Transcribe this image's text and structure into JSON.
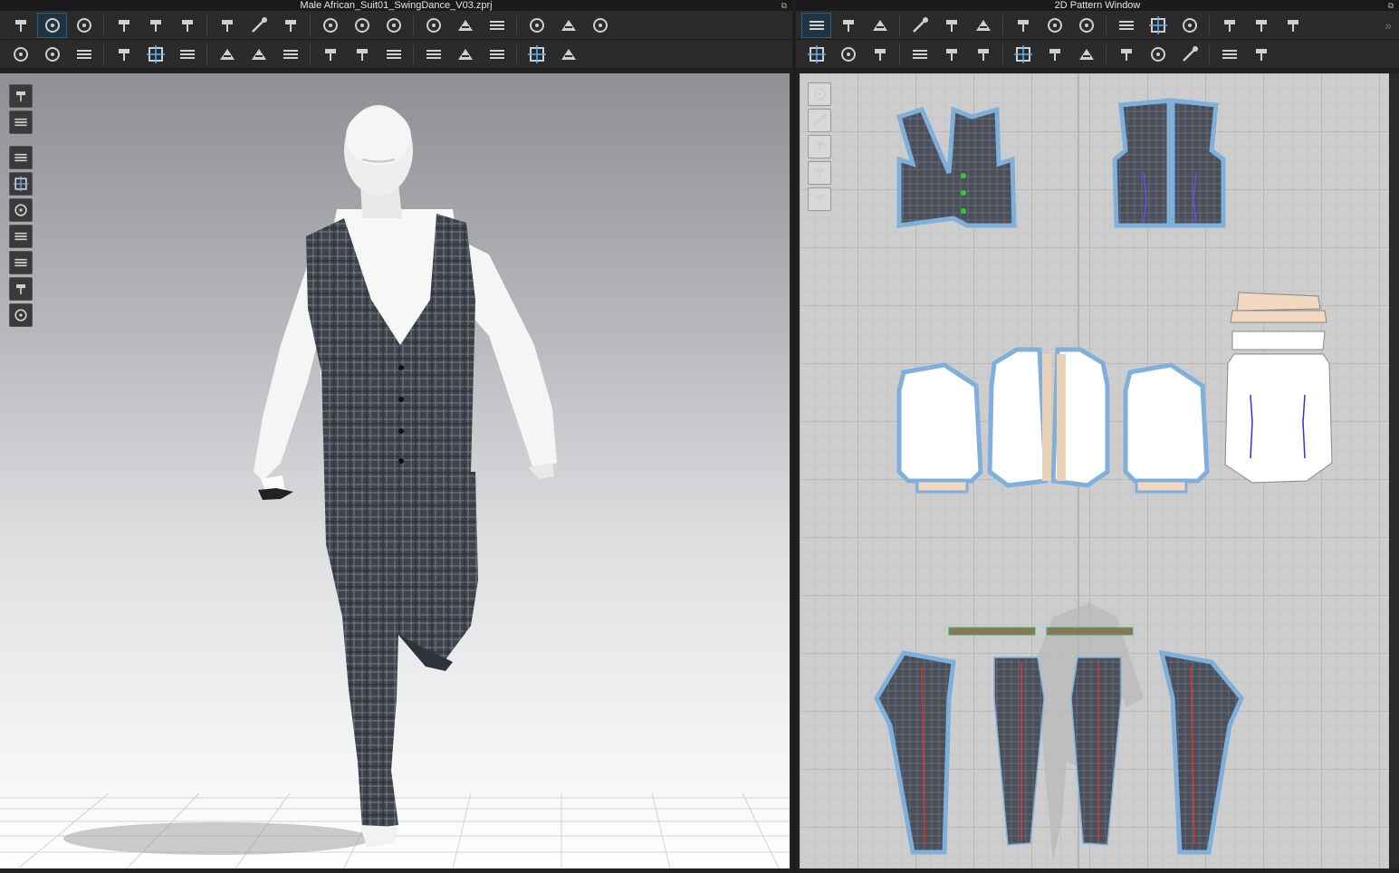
{
  "window3d": {
    "title": "Male African_Suit01_SwingDance_V03.zprj"
  },
  "window2d": {
    "title": "2D Pattern Window"
  },
  "toolbar3d_row1": [
    {
      "icon": "simulation-icon"
    },
    {
      "icon": "select-move-icon",
      "selected": true
    },
    {
      "icon": "transform-pattern-icon"
    },
    {
      "icon": "fold-arrangement-icon"
    },
    {
      "icon": "fold-icon"
    },
    {
      "icon": "fold-inner-icon"
    },
    {
      "icon": "tack-icon"
    },
    {
      "icon": "pin-icon"
    },
    {
      "icon": "strengthen-icon"
    },
    {
      "icon": "select-mesh-icon"
    },
    {
      "icon": "garment-fit-icon"
    },
    {
      "icon": "shirt-icon"
    },
    {
      "icon": "avatar-pose-icon"
    },
    {
      "icon": "measure-icon"
    },
    {
      "icon": "tape-measure-icon"
    },
    {
      "icon": "ruler-icon"
    },
    {
      "icon": "shirt-arrange-icon"
    },
    {
      "icon": "shirt-reset-icon"
    }
  ],
  "toolbar3d_row2": [
    {
      "icon": "avatar-walk-icon"
    },
    {
      "icon": "brush-icon"
    },
    {
      "icon": "stitch-icon"
    },
    {
      "icon": "seam-icon"
    },
    {
      "icon": "scissors-icon"
    },
    {
      "icon": "sewing-icon"
    },
    {
      "icon": "pattern-icon"
    },
    {
      "icon": "check-pattern-icon"
    },
    {
      "icon": "button-icon"
    },
    {
      "icon": "buttonhole-icon"
    },
    {
      "icon": "snap-icon"
    },
    {
      "icon": "zipper-icon"
    },
    {
      "icon": "piping-icon"
    },
    {
      "icon": "texture-icon"
    },
    {
      "icon": "texture-edit-icon"
    },
    {
      "icon": "gradient-icon"
    },
    {
      "icon": "stretch-icon"
    }
  ],
  "toolbar2d_row1": [
    {
      "icon": "edit-pattern-icon",
      "selected": true
    },
    {
      "icon": "edit-point-icon"
    },
    {
      "icon": "polygon-icon"
    },
    {
      "icon": "rectangle-icon"
    },
    {
      "icon": "internal-polygon-icon"
    },
    {
      "icon": "internal-rect-icon"
    },
    {
      "icon": "dart-icon"
    },
    {
      "icon": "trace-icon"
    },
    {
      "icon": "curve-icon"
    },
    {
      "icon": "fold-pattern-icon"
    },
    {
      "icon": "sew-line-icon"
    },
    {
      "icon": "grain-icon"
    },
    {
      "icon": "text-icon"
    },
    {
      "icon": "text-style-icon"
    },
    {
      "icon": "grid-icon"
    }
  ],
  "toolbar2d_row2": [
    {
      "icon": "segment-sewing-icon"
    },
    {
      "icon": "free-sewing-icon"
    },
    {
      "icon": "tuck-icon"
    },
    {
      "icon": "check-sewing-icon"
    },
    {
      "icon": "iron-icon"
    },
    {
      "icon": "garment-2d-icon"
    },
    {
      "icon": "shirt-2d-icon"
    },
    {
      "icon": "pattern-2d-icon"
    },
    {
      "icon": "pattern-check-icon"
    },
    {
      "icon": "line-icon"
    },
    {
      "icon": "dashed-line-icon"
    },
    {
      "icon": "stitch-2d-icon"
    },
    {
      "icon": "zigzag-icon"
    },
    {
      "icon": "trim-icon"
    }
  ],
  "sidebar3d": [
    "view-layer-icon",
    "garment-view-icon",
    "show-garment-icon",
    "show-pin-icon",
    "show-avatar-icon",
    "texture-view-icon",
    "render-icon",
    "skin-icon",
    "environment-icon"
  ],
  "sidebar2d": [
    "pattern-pen-icon",
    "garment-2d-view-icon",
    "info-icon",
    "texture-2d-icon",
    "lock-icon"
  ],
  "more_label": "»"
}
